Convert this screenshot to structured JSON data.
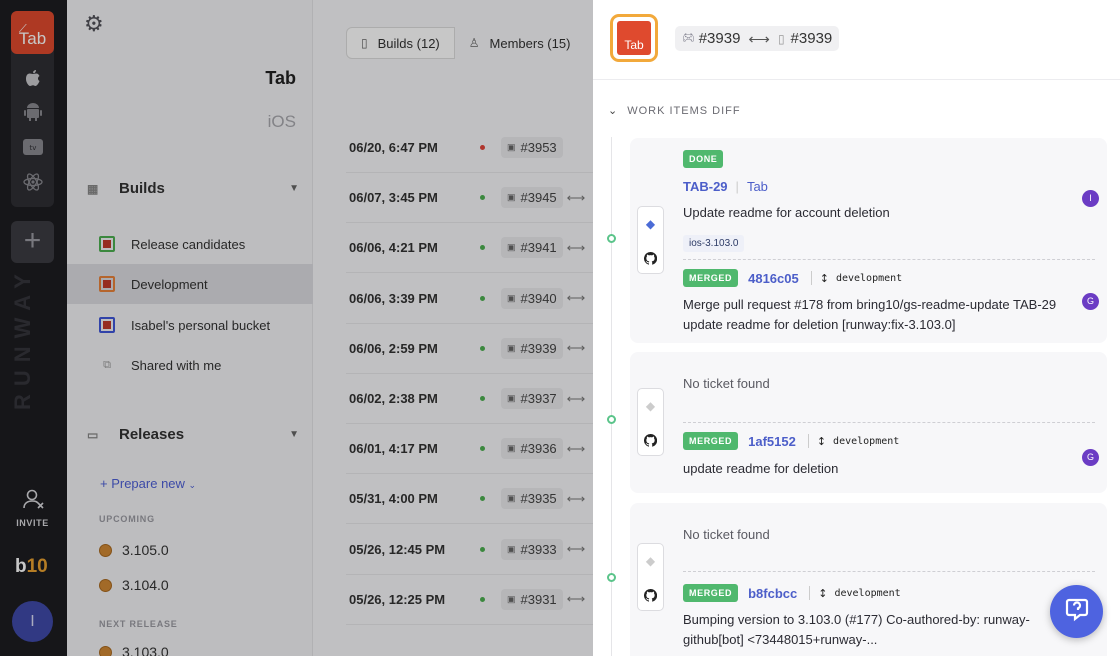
{
  "rail": {
    "app_tab_label": "Tab",
    "brand": "RUNWAY",
    "invite_label": "INVITE",
    "logo_b": "b",
    "logo_ten": "10",
    "avatar_initial": "I",
    "add_symbol": "+"
  },
  "sidebar": {
    "app_name": "Tab",
    "platform": "iOS",
    "builds_heading": "Builds",
    "buckets": [
      {
        "label": "Release candidates",
        "color": "#4caf50"
      },
      {
        "label": "Development",
        "color": "#e8823a"
      },
      {
        "label": "Isabel's personal bucket",
        "color": "#3f57d9"
      },
      {
        "label": "Shared with me"
      }
    ],
    "releases_heading": "Releases",
    "prepare_new": "+ Prepare new",
    "upcoming_label": "UPCOMING",
    "upcoming": [
      "3.105.0",
      "3.104.0"
    ],
    "next_release_label": "NEXT RELEASE",
    "next_release": "3.103.0"
  },
  "tabs": {
    "builds": "Builds (12)",
    "members": "Members (15)"
  },
  "builds": [
    {
      "date": "06/20, 6:47 PM",
      "build": "#3953",
      "status": "#e0453a"
    },
    {
      "date": "06/07, 3:45 PM",
      "build": "#3945",
      "status": "#4caf50"
    },
    {
      "date": "06/06, 4:21 PM",
      "build": "#3941",
      "status": "#4caf50"
    },
    {
      "date": "06/06, 3:39 PM",
      "build": "#3940",
      "status": "#4caf50"
    },
    {
      "date": "06/06, 2:59 PM",
      "build": "#3939",
      "status": "#4caf50"
    },
    {
      "date": "06/02, 2:38 PM",
      "build": "#3937",
      "status": "#4caf50"
    },
    {
      "date": "06/01, 4:17 PM",
      "build": "#3936",
      "status": "#4caf50"
    },
    {
      "date": "05/31, 4:00 PM",
      "build": "#3935",
      "status": "#4caf50"
    },
    {
      "date": "05/26, 12:45 PM",
      "build": "#3933",
      "status": "#4caf50"
    },
    {
      "date": "05/26, 12:25 PM",
      "build": "#3931",
      "status": "#4caf50"
    }
  ],
  "panel": {
    "logo_label": "Tab",
    "from_build": "#3939",
    "arrow": "⟷",
    "to_build": "#3939",
    "section_title": "WORK ITEMS DIFF",
    "items": [
      {
        "status": "DONE",
        "ticket_id": "TAB-29",
        "project": "Tab",
        "ticket_title": "Update readme for account deletion",
        "tag": "ios-3.103.0",
        "ticket_avatar": "I",
        "merged_label": "MERGED",
        "sha": "4816c05",
        "branch": "development",
        "commit_message": "Merge pull request #178 from bring10/gs-readme-update TAB-29 update readme for deletion [runway:fix-3.103.0]",
        "commit_avatar": "G"
      },
      {
        "no_ticket": "No ticket found",
        "merged_label": "MERGED",
        "sha": "1af5152",
        "branch": "development",
        "commit_message": "update readme for deletion",
        "commit_avatar": "G"
      },
      {
        "no_ticket": "No ticket found",
        "merged_label": "MERGED",
        "sha": "b8fcbcc",
        "branch": "development",
        "commit_message": "Bumping version to 3.103.0 (#177) Co-authored-by: runway-github[bot] <73448015+runway-..."
      }
    ]
  },
  "colors": {
    "accent": "#4e63e0",
    "merged": "#50b86e",
    "brand_orange": "#df4a2e"
  }
}
